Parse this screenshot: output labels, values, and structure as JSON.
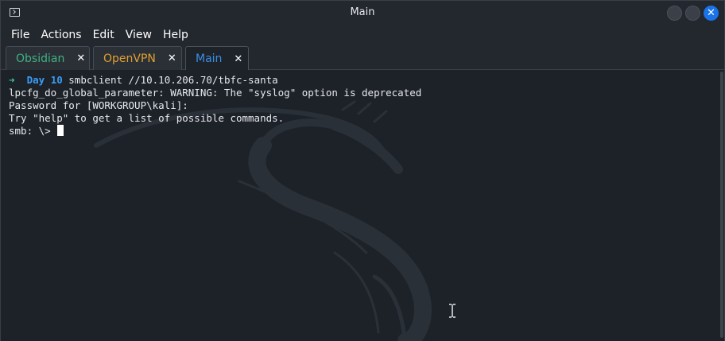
{
  "window": {
    "title": "Main",
    "close_glyph": "✕"
  },
  "menubar": {
    "items": [
      "File",
      "Actions",
      "Edit",
      "View",
      "Help"
    ]
  },
  "tabs": [
    {
      "label": "Obsidian",
      "color": "#3fb17f",
      "close_glyph": "✕",
      "active": false
    },
    {
      "label": "OpenVPN",
      "color": "#e0a030",
      "close_glyph": "✕",
      "active": false
    },
    {
      "label": "Main",
      "color": "#3a8ee6",
      "close_glyph": "✕",
      "active": true
    }
  ],
  "terminal": {
    "prompt": {
      "arrow": "➜",
      "dir": "Day 10",
      "command": "smbclient //10.10.206.70/tbfc-santa"
    },
    "output": [
      "lpcfg_do_global_parameter: WARNING: The \"syslog\" option is deprecated",
      "Password for [WORKGROUP\\kali]:",
      "Try \"help\" to get a list of possible commands."
    ],
    "smb_prompt": "smb: \\> "
  },
  "colors": {
    "accent": "#1a73e8",
    "prompt_arrow": "#39c4a9",
    "prompt_dir": "#3a9cf5"
  }
}
